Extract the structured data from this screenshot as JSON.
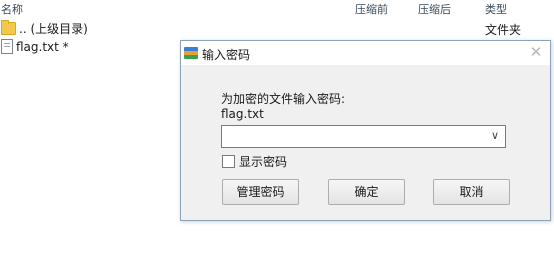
{
  "columns": {
    "name": "名称",
    "compressed_before": "压缩前",
    "compressed_after": "压缩后",
    "type": "类型"
  },
  "rows": [
    {
      "name": ".. (上级目录)",
      "type": "文件夹",
      "icon": "folder-icon"
    },
    {
      "name": "flag.txt *",
      "type": "",
      "icon": "text-file-icon"
    }
  ],
  "dialog": {
    "title": "输入密码",
    "close": "✕",
    "prompt": "为加密的文件输入密码:",
    "filename": "flag.txt",
    "password_value": "",
    "show_password_label": "显示密码",
    "buttons": {
      "manage": "管理密码",
      "ok": "确定",
      "cancel": "取消"
    }
  }
}
